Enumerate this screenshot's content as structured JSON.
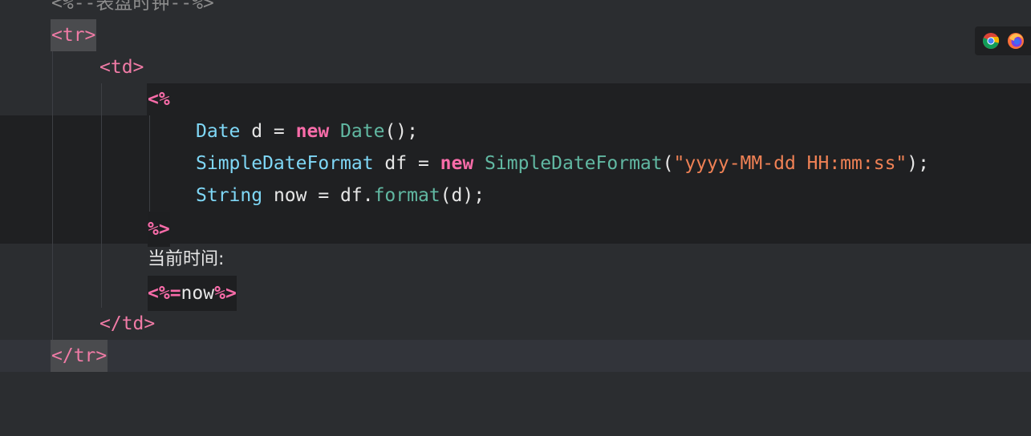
{
  "editor": {
    "lines": {
      "comment": "<%--表盘时钟--%>",
      "tr_open": "<tr>",
      "td_open": "<td>",
      "scriptlet_open": "<%",
      "l1_type": "Date",
      "l1_var": " d = ",
      "l1_new": "new",
      "l1_cls": " Date",
      "l1_end": "();",
      "l2_type": "SimpleDateFormat",
      "l2_var": " df = ",
      "l2_new": "new",
      "l2_cls": " SimpleDateFormat",
      "l2_paren": "(",
      "l2_str": "\"yyyy-MM-dd HH:mm:ss\"",
      "l2_end": ");",
      "l3_type": "String",
      "l3_var": " now = df.",
      "l3_method": "format",
      "l3_end": "(d);",
      "scriptlet_close": "%>",
      "label_text": "当前时间:",
      "expr_open": "<%=",
      "expr_var": "now",
      "expr_close": "%>",
      "td_close": "</td>",
      "tr_close": "</tr>"
    }
  },
  "browser_bar": {
    "icons": [
      "chrome-icon",
      "firefox-icon"
    ]
  },
  "colors": {
    "background": "#2b2d30",
    "tag": "#f07ba6",
    "keyword": "#f86ca9",
    "type": "#7fd7f6",
    "class": "#61b8a2",
    "string": "#ef8155"
  }
}
